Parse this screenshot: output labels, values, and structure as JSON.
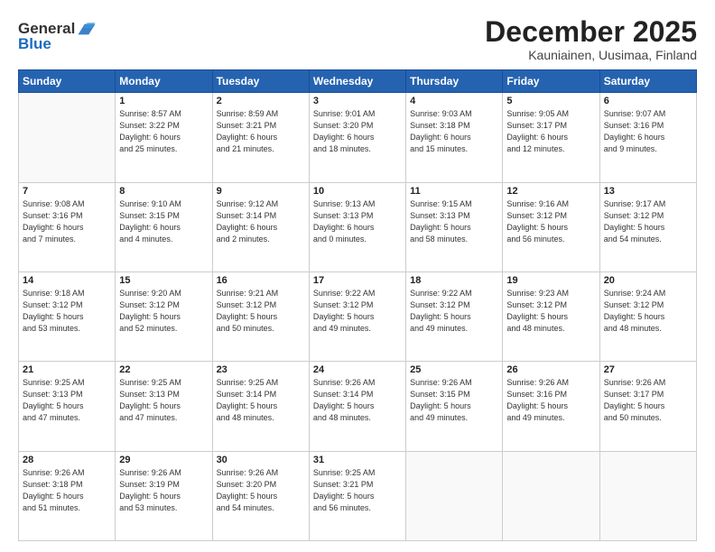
{
  "header": {
    "logo": {
      "line1": "General",
      "line2": "Blue"
    },
    "title": "December 2025",
    "subtitle": "Kauniainen, Uusimaa, Finland"
  },
  "weekdays": [
    "Sunday",
    "Monday",
    "Tuesday",
    "Wednesday",
    "Thursday",
    "Friday",
    "Saturday"
  ],
  "weeks": [
    [
      {
        "day": "",
        "info": ""
      },
      {
        "day": "1",
        "info": "Sunrise: 8:57 AM\nSunset: 3:22 PM\nDaylight: 6 hours\nand 25 minutes."
      },
      {
        "day": "2",
        "info": "Sunrise: 8:59 AM\nSunset: 3:21 PM\nDaylight: 6 hours\nand 21 minutes."
      },
      {
        "day": "3",
        "info": "Sunrise: 9:01 AM\nSunset: 3:20 PM\nDaylight: 6 hours\nand 18 minutes."
      },
      {
        "day": "4",
        "info": "Sunrise: 9:03 AM\nSunset: 3:18 PM\nDaylight: 6 hours\nand 15 minutes."
      },
      {
        "day": "5",
        "info": "Sunrise: 9:05 AM\nSunset: 3:17 PM\nDaylight: 6 hours\nand 12 minutes."
      },
      {
        "day": "6",
        "info": "Sunrise: 9:07 AM\nSunset: 3:16 PM\nDaylight: 6 hours\nand 9 minutes."
      }
    ],
    [
      {
        "day": "7",
        "info": "Sunrise: 9:08 AM\nSunset: 3:16 PM\nDaylight: 6 hours\nand 7 minutes."
      },
      {
        "day": "8",
        "info": "Sunrise: 9:10 AM\nSunset: 3:15 PM\nDaylight: 6 hours\nand 4 minutes."
      },
      {
        "day": "9",
        "info": "Sunrise: 9:12 AM\nSunset: 3:14 PM\nDaylight: 6 hours\nand 2 minutes."
      },
      {
        "day": "10",
        "info": "Sunrise: 9:13 AM\nSunset: 3:13 PM\nDaylight: 6 hours\nand 0 minutes."
      },
      {
        "day": "11",
        "info": "Sunrise: 9:15 AM\nSunset: 3:13 PM\nDaylight: 5 hours\nand 58 minutes."
      },
      {
        "day": "12",
        "info": "Sunrise: 9:16 AM\nSunset: 3:12 PM\nDaylight: 5 hours\nand 56 minutes."
      },
      {
        "day": "13",
        "info": "Sunrise: 9:17 AM\nSunset: 3:12 PM\nDaylight: 5 hours\nand 54 minutes."
      }
    ],
    [
      {
        "day": "14",
        "info": "Sunrise: 9:18 AM\nSunset: 3:12 PM\nDaylight: 5 hours\nand 53 minutes."
      },
      {
        "day": "15",
        "info": "Sunrise: 9:20 AM\nSunset: 3:12 PM\nDaylight: 5 hours\nand 52 minutes."
      },
      {
        "day": "16",
        "info": "Sunrise: 9:21 AM\nSunset: 3:12 PM\nDaylight: 5 hours\nand 50 minutes."
      },
      {
        "day": "17",
        "info": "Sunrise: 9:22 AM\nSunset: 3:12 PM\nDaylight: 5 hours\nand 49 minutes."
      },
      {
        "day": "18",
        "info": "Sunrise: 9:22 AM\nSunset: 3:12 PM\nDaylight: 5 hours\nand 49 minutes."
      },
      {
        "day": "19",
        "info": "Sunrise: 9:23 AM\nSunset: 3:12 PM\nDaylight: 5 hours\nand 48 minutes."
      },
      {
        "day": "20",
        "info": "Sunrise: 9:24 AM\nSunset: 3:12 PM\nDaylight: 5 hours\nand 48 minutes."
      }
    ],
    [
      {
        "day": "21",
        "info": "Sunrise: 9:25 AM\nSunset: 3:13 PM\nDaylight: 5 hours\nand 47 minutes."
      },
      {
        "day": "22",
        "info": "Sunrise: 9:25 AM\nSunset: 3:13 PM\nDaylight: 5 hours\nand 47 minutes."
      },
      {
        "day": "23",
        "info": "Sunrise: 9:25 AM\nSunset: 3:14 PM\nDaylight: 5 hours\nand 48 minutes."
      },
      {
        "day": "24",
        "info": "Sunrise: 9:26 AM\nSunset: 3:14 PM\nDaylight: 5 hours\nand 48 minutes."
      },
      {
        "day": "25",
        "info": "Sunrise: 9:26 AM\nSunset: 3:15 PM\nDaylight: 5 hours\nand 49 minutes."
      },
      {
        "day": "26",
        "info": "Sunrise: 9:26 AM\nSunset: 3:16 PM\nDaylight: 5 hours\nand 49 minutes."
      },
      {
        "day": "27",
        "info": "Sunrise: 9:26 AM\nSunset: 3:17 PM\nDaylight: 5 hours\nand 50 minutes."
      }
    ],
    [
      {
        "day": "28",
        "info": "Sunrise: 9:26 AM\nSunset: 3:18 PM\nDaylight: 5 hours\nand 51 minutes."
      },
      {
        "day": "29",
        "info": "Sunrise: 9:26 AM\nSunset: 3:19 PM\nDaylight: 5 hours\nand 53 minutes."
      },
      {
        "day": "30",
        "info": "Sunrise: 9:26 AM\nSunset: 3:20 PM\nDaylight: 5 hours\nand 54 minutes."
      },
      {
        "day": "31",
        "info": "Sunrise: 9:25 AM\nSunset: 3:21 PM\nDaylight: 5 hours\nand 56 minutes."
      },
      {
        "day": "",
        "info": ""
      },
      {
        "day": "",
        "info": ""
      },
      {
        "day": "",
        "info": ""
      }
    ]
  ]
}
